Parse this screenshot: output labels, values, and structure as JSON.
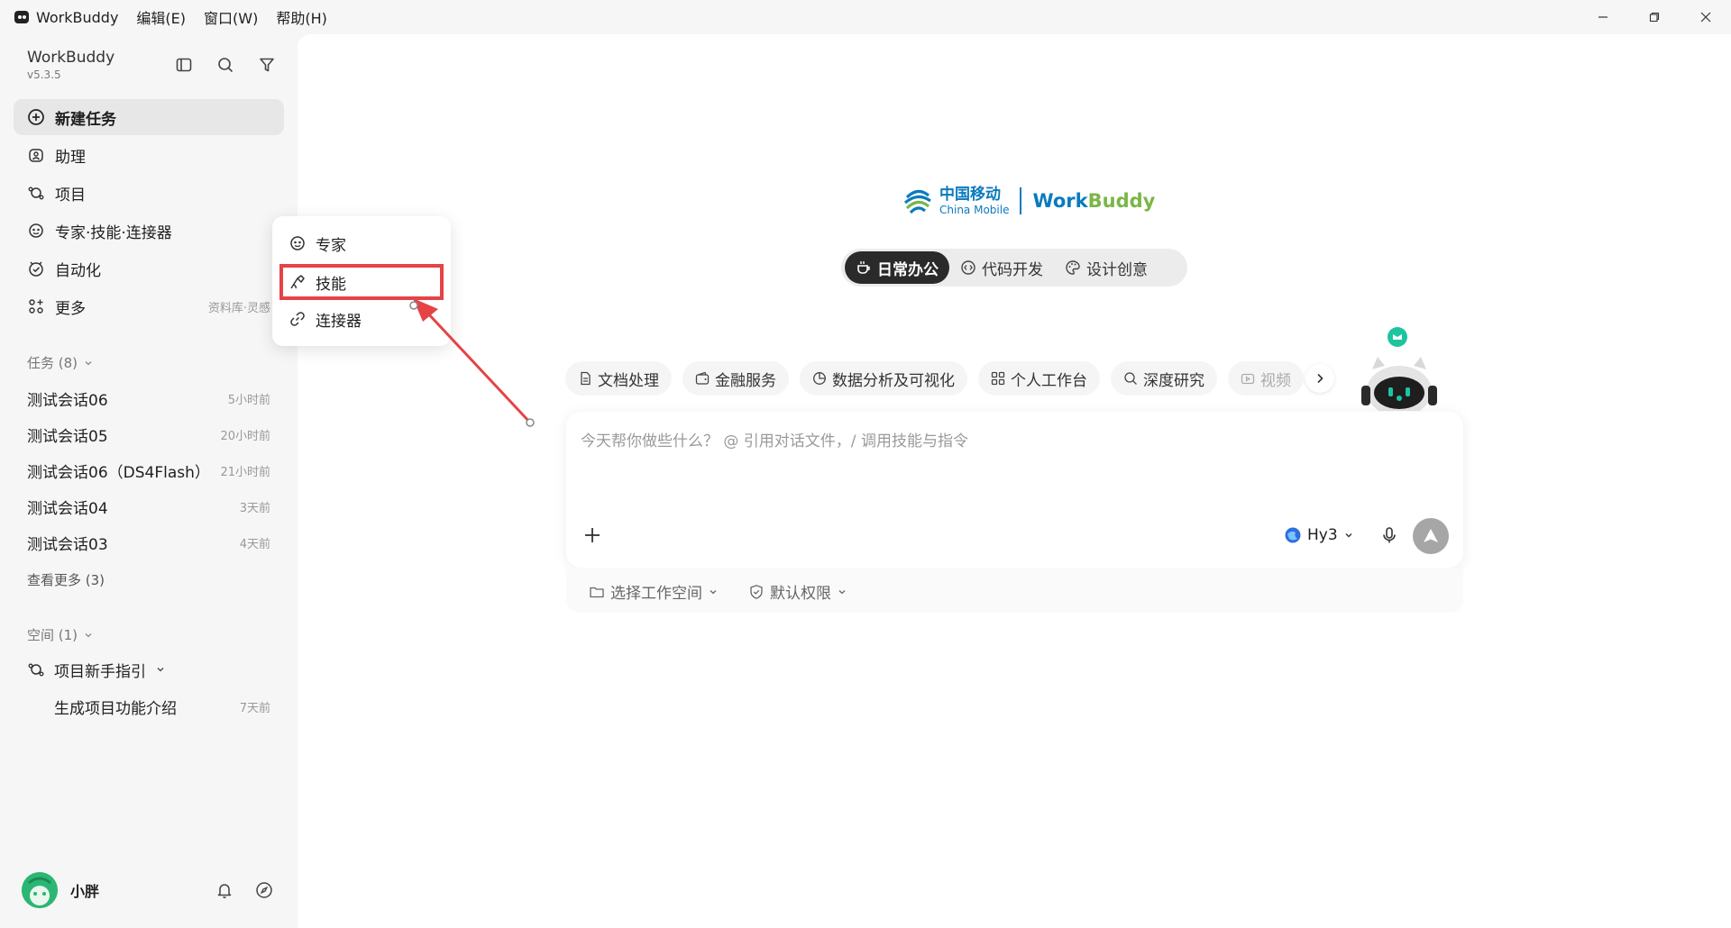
{
  "titlebar": {
    "app_name": "WorkBuddy",
    "menus": [
      "编辑(E)",
      "窗口(W)",
      "帮助(H)"
    ]
  },
  "sidebar": {
    "brand": "WorkBuddy",
    "version": "v5.3.5",
    "nav": [
      {
        "label": "新建任务",
        "icon": "plus-circle-icon"
      },
      {
        "label": "助理",
        "icon": "assistant-icon"
      },
      {
        "label": "项目",
        "icon": "project-icon"
      },
      {
        "label": "专家·技能·连接器",
        "icon": "expert-icon"
      },
      {
        "label": "自动化",
        "icon": "automation-icon"
      },
      {
        "label": "更多",
        "icon": "apps-icon",
        "sub": "资料库·灵感"
      }
    ],
    "tasks_header": "任务 (8)",
    "tasks": [
      {
        "name": "测试会话06",
        "time": "5小时前"
      },
      {
        "name": "测试会话05",
        "time": "20小时前"
      },
      {
        "name": "测试会话06（DS4Flash）",
        "time": "21小时前"
      },
      {
        "name": "测试会话04",
        "time": "3天前"
      },
      {
        "name": "测试会话03",
        "time": "4天前"
      }
    ],
    "see_more": "查看更多 (3)",
    "spaces_header": "空间 (1)",
    "space_name": "项目新手指引",
    "space_child": {
      "name": "生成项目功能介绍",
      "time": "7天前"
    },
    "user_name": "小胖"
  },
  "popup": {
    "items": [
      "专家",
      "技能",
      "连接器"
    ]
  },
  "main": {
    "logo_cn": "中国移动",
    "logo_en": "China Mobile",
    "logo_product_a": "Work",
    "logo_product_b": "Buddy",
    "mode_tabs": [
      "日常办公",
      "代码开发",
      "设计创意"
    ],
    "chips": [
      "文档处理",
      "金融服务",
      "数据分析及可视化",
      "个人工作台",
      "深度研究",
      "视频"
    ],
    "input_placeholder": "今天帮你做些什么？ @ 引用对话文件，/ 调用技能与指令",
    "model": "Hy3",
    "workspace_select": "选择工作空间",
    "permission": "默认权限"
  },
  "colors": {
    "accent_red": "#e54346",
    "brand_blue": "#0a7bbd",
    "brand_green": "#7ab648",
    "active_tab": "#2a2a2a"
  }
}
